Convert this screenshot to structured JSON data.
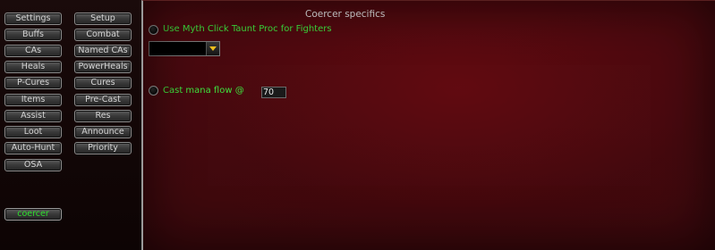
{
  "sidebar": {
    "left_column": [
      {
        "label": "Settings"
      },
      {
        "label": "Buffs"
      },
      {
        "label": "CAs"
      },
      {
        "label": "Heals"
      },
      {
        "label": "P-Cures"
      },
      {
        "label": "Items"
      },
      {
        "label": "Assist"
      },
      {
        "label": "Loot"
      },
      {
        "label": "Auto-Hunt"
      },
      {
        "label": "OSA"
      }
    ],
    "right_column": [
      {
        "label": "Setup"
      },
      {
        "label": "Combat"
      },
      {
        "label": "Named CAs"
      },
      {
        "label": "PowerHeals"
      },
      {
        "label": "Cures"
      },
      {
        "label": "Pre-Cast"
      },
      {
        "label": "Res"
      },
      {
        "label": "Announce"
      },
      {
        "label": "Priority"
      }
    ],
    "profile_button": {
      "label": "coercer"
    }
  },
  "panel": {
    "title": "Coercer specifics",
    "option_taunt": {
      "label": "Use Myth Click Taunt Proc for Fighters",
      "checked": false
    },
    "fighter_dropdown": {
      "value": ""
    },
    "option_mana_flow": {
      "label": "Cast mana flow @",
      "checked": false,
      "value": "70"
    }
  },
  "colors": {
    "option_text": "#3ee03e",
    "active_button_text": "#2ee02e",
    "panel_background": "#430a0f",
    "dropdown_arrow": "#f0c020"
  }
}
